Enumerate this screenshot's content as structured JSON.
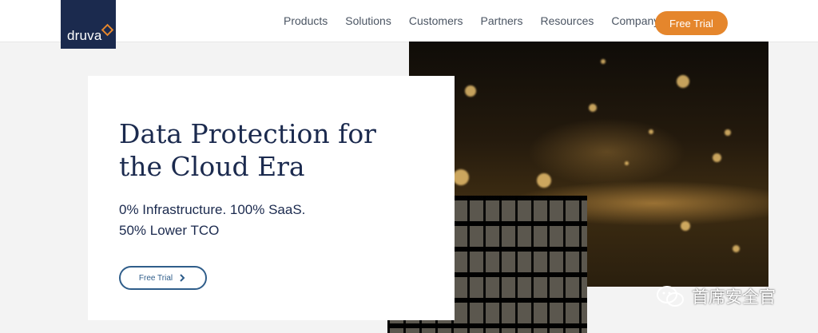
{
  "brand": {
    "logo_text": "druva",
    "accent": "#e5862c",
    "navy": "#1b2a4e"
  },
  "nav": {
    "items": [
      "Products",
      "Solutions",
      "Customers",
      "Partners",
      "Resources",
      "Company"
    ],
    "cta_label": "Free Trial"
  },
  "hero": {
    "title_line1": "Data Protection for",
    "title_line2": "the Cloud Era",
    "subtitle_line1": "0% Infrastructure. 100% SaaS.",
    "subtitle_line2": "50% Lower TCO",
    "button_label": "Free Trial",
    "button_icon": "chevron-right-icon"
  },
  "watermark": {
    "icon": "wechat-icon",
    "text": "首席安全官"
  }
}
